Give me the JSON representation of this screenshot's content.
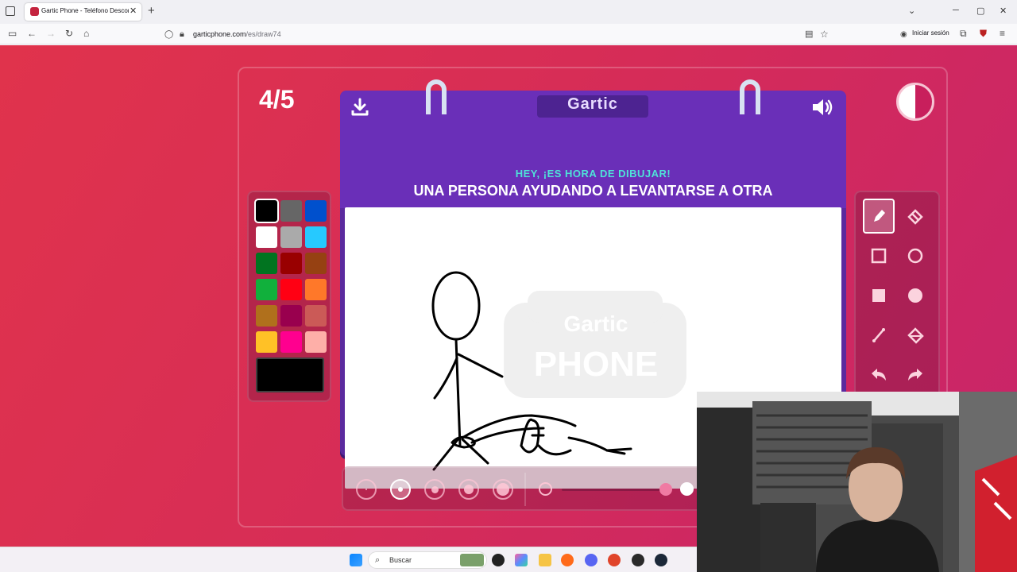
{
  "browser": {
    "tab_title": "Gartic Phone - Teléfono Descon",
    "tab_close": "✕",
    "new_tab": "+",
    "url_domain": "garticphone.com",
    "url_path": "/es/draw74",
    "signin_label": "Iniciar sesión"
  },
  "game": {
    "round": "4/5",
    "logo": "Gartic",
    "subtitle": "HEY, ¡ES HORA DE DIBUJAR!",
    "prompt": "UNA PERSONA AYUDANDO A LEVANTARSE A OTRA",
    "watermark_line1": "Gartic",
    "watermark_line2": "PHONE"
  },
  "palette": {
    "colors": [
      "#000000",
      "#666666",
      "#0050cd",
      "#ffffff",
      "#aaaaaa",
      "#26c9ff",
      "#017420",
      "#990000",
      "#964112",
      "#11b03c",
      "#ff0013",
      "#ff7829",
      "#b0701c",
      "#99004e",
      "#cb5a57",
      "#ffc126",
      "#ff008f",
      "#feafa8"
    ],
    "current": "#000000"
  },
  "tools": [
    "pencil-icon",
    "eraser-icon",
    "rectangle-outline-icon",
    "circle-outline-icon",
    "rectangle-filled-icon",
    "circle-filled-icon",
    "line-icon",
    "fill-bucket-icon",
    "undo-icon",
    "redo-icon"
  ],
  "brush": {
    "sizes": 5,
    "selected_size": 2,
    "opacity": 1.0
  },
  "taskbar": {
    "search_label": "Buscar"
  }
}
